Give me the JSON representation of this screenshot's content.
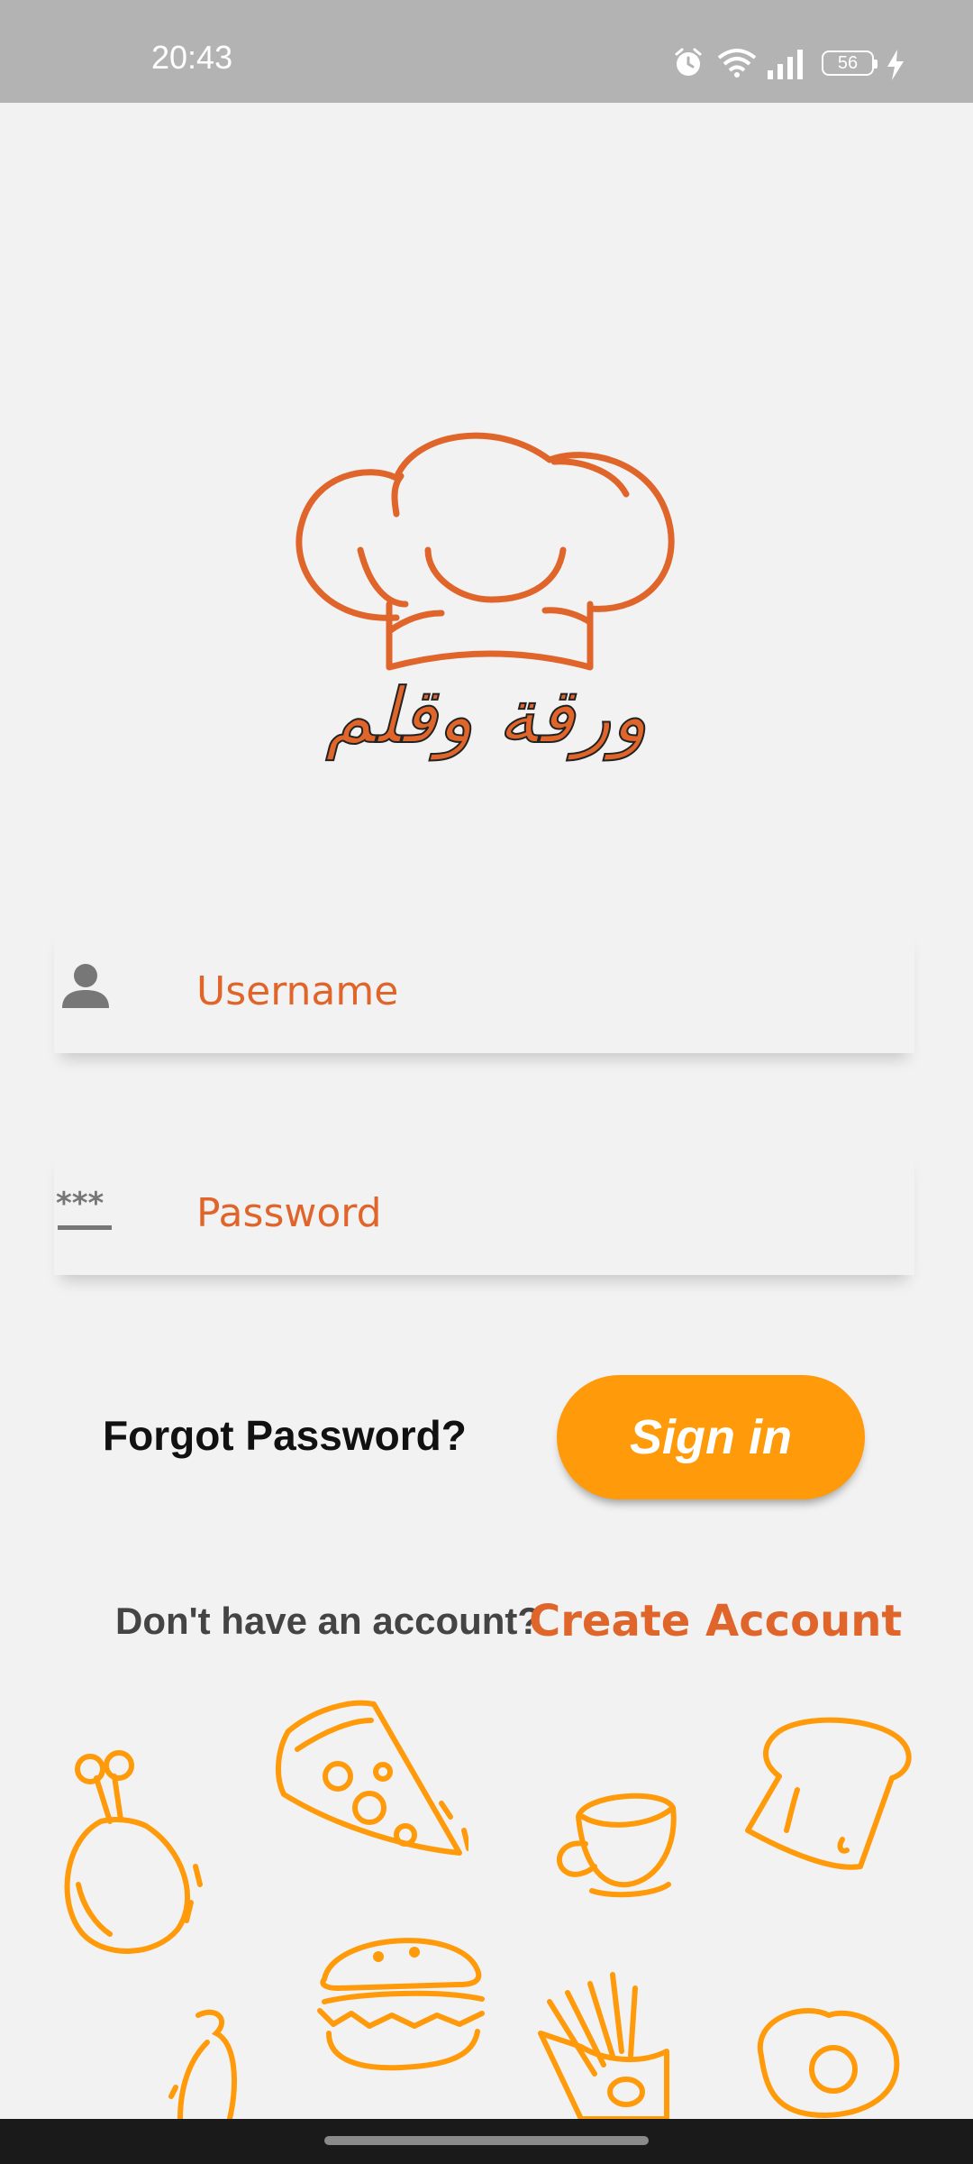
{
  "status_bar": {
    "time": "20:43",
    "battery": "56",
    "icons": [
      "alarm-icon",
      "wifi-icon",
      "signal-icon",
      "battery-icon",
      "charging-icon"
    ]
  },
  "logo": {
    "icon": "chef-hat-icon",
    "text": "ورقة وقلم"
  },
  "login_form": {
    "username_placeholder": "Username",
    "password_placeholder": "Password",
    "username_icon": "person-icon",
    "password_icon": "password-asterisk-icon"
  },
  "actions": {
    "forgot_password": "Forgot Password?",
    "sign_in": "Sign in",
    "no_account": "Don't have an account?",
    "create_account": "Create Account"
  },
  "decorations": [
    "chicken-leg-icon",
    "pizza-slice-icon",
    "coffee-cup-icon",
    "toast-icon",
    "burger-icon",
    "fries-icon",
    "egg-icon",
    "carrot-icon"
  ],
  "colors": {
    "accent": "#e0652b",
    "button": "#ff9a0a",
    "doodle": "#ff9a0a",
    "background": "#f2f2f2",
    "status_bar": "#b3b3b3"
  }
}
